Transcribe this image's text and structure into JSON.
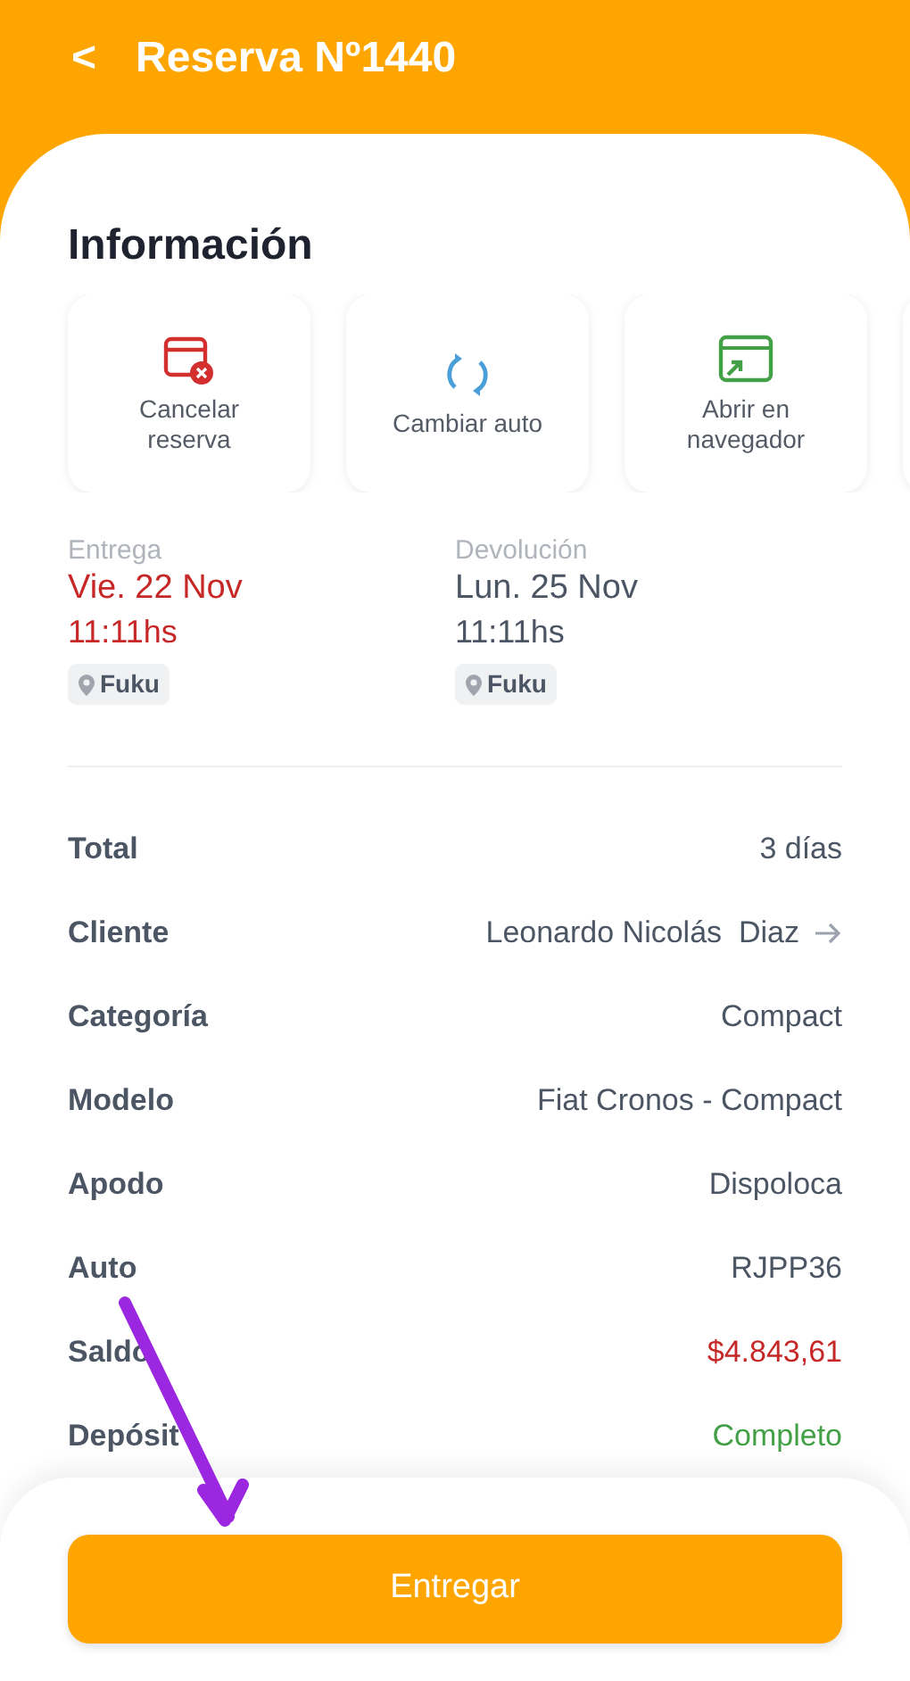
{
  "header": {
    "back": "<",
    "title": "Reserva Nº1440"
  },
  "section_title": "Información",
  "actions": [
    {
      "label": "Cancelar reserva",
      "kind": "cancel"
    },
    {
      "label": "Cambiar auto",
      "kind": "swap"
    },
    {
      "label": "Abrir en navegador",
      "kind": "browser"
    }
  ],
  "schedule": [
    {
      "label": "Entrega",
      "date": "Vie. 22 Nov",
      "time": "11:11hs",
      "place": "Fuku",
      "color": "#c62828"
    },
    {
      "label": "Devolución",
      "date": "Lun. 25 Nov",
      "time": "11:11hs",
      "place": "Fuku",
      "color": "#4b5563"
    }
  ],
  "details": [
    {
      "label": "Total",
      "value": "3 días",
      "kind": "plain",
      "color": "#4b5563"
    },
    {
      "label": "Cliente",
      "value": "Leonardo Nicolás  Diaz",
      "kind": "link",
      "color": "#4b5563"
    },
    {
      "label": "Categoría",
      "value": "Compact",
      "kind": "plain",
      "color": "#4b5563"
    },
    {
      "label": "Modelo",
      "value": "Fiat Cronos - Compact",
      "kind": "plain",
      "color": "#4b5563"
    },
    {
      "label": "Apodo",
      "value": "Dispoloca",
      "kind": "plain",
      "color": "#4b5563"
    },
    {
      "label": "Auto",
      "value": "RJPP36",
      "kind": "plain",
      "color": "#4b5563"
    },
    {
      "label": "Saldo",
      "value": "$4.843,61",
      "kind": "plain",
      "color": "#c62828"
    },
    {
      "label": "Depósit",
      "value": "Completo",
      "kind": "plain",
      "color": "#43a047"
    }
  ],
  "primary_button": "Entregar"
}
